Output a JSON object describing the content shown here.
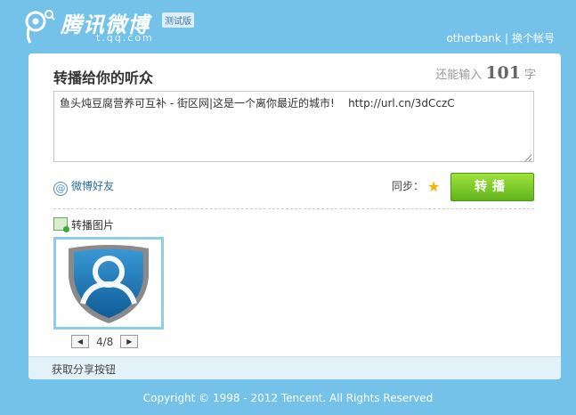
{
  "header": {
    "logo_text": "腾讯微博",
    "logo_sub": "t.qq.com",
    "logo_badge": "测试版",
    "username": "otherbank",
    "separator": "|",
    "switch_account": "换个帐号"
  },
  "panel": {
    "title": "转播给你的听众",
    "counter_prefix": "还能输入",
    "counter_value": "101",
    "counter_suffix": "字",
    "message": "鱼头炖豆腐营养可互补 - 街区网|这是一个离你最近的城市!    http://url.cn/3dCczC",
    "friends_label": "微博好友",
    "sync_label": "同步：",
    "submit_label": "转播",
    "image_label": "转播图片",
    "pager": {
      "current": "4/8",
      "prev_icon": "left-arrow-icon",
      "next_icon": "right-arrow-icon"
    },
    "share_link": "获取分享按钮"
  },
  "footer": {
    "copyright": "Copyright © 1998 - 2012 Tencent. All Rights Reserved"
  },
  "colors": {
    "background": "#74c2ea",
    "submit": "#6cc021",
    "link": "#2a6fa0",
    "thumb_border": "#8ecde8"
  }
}
